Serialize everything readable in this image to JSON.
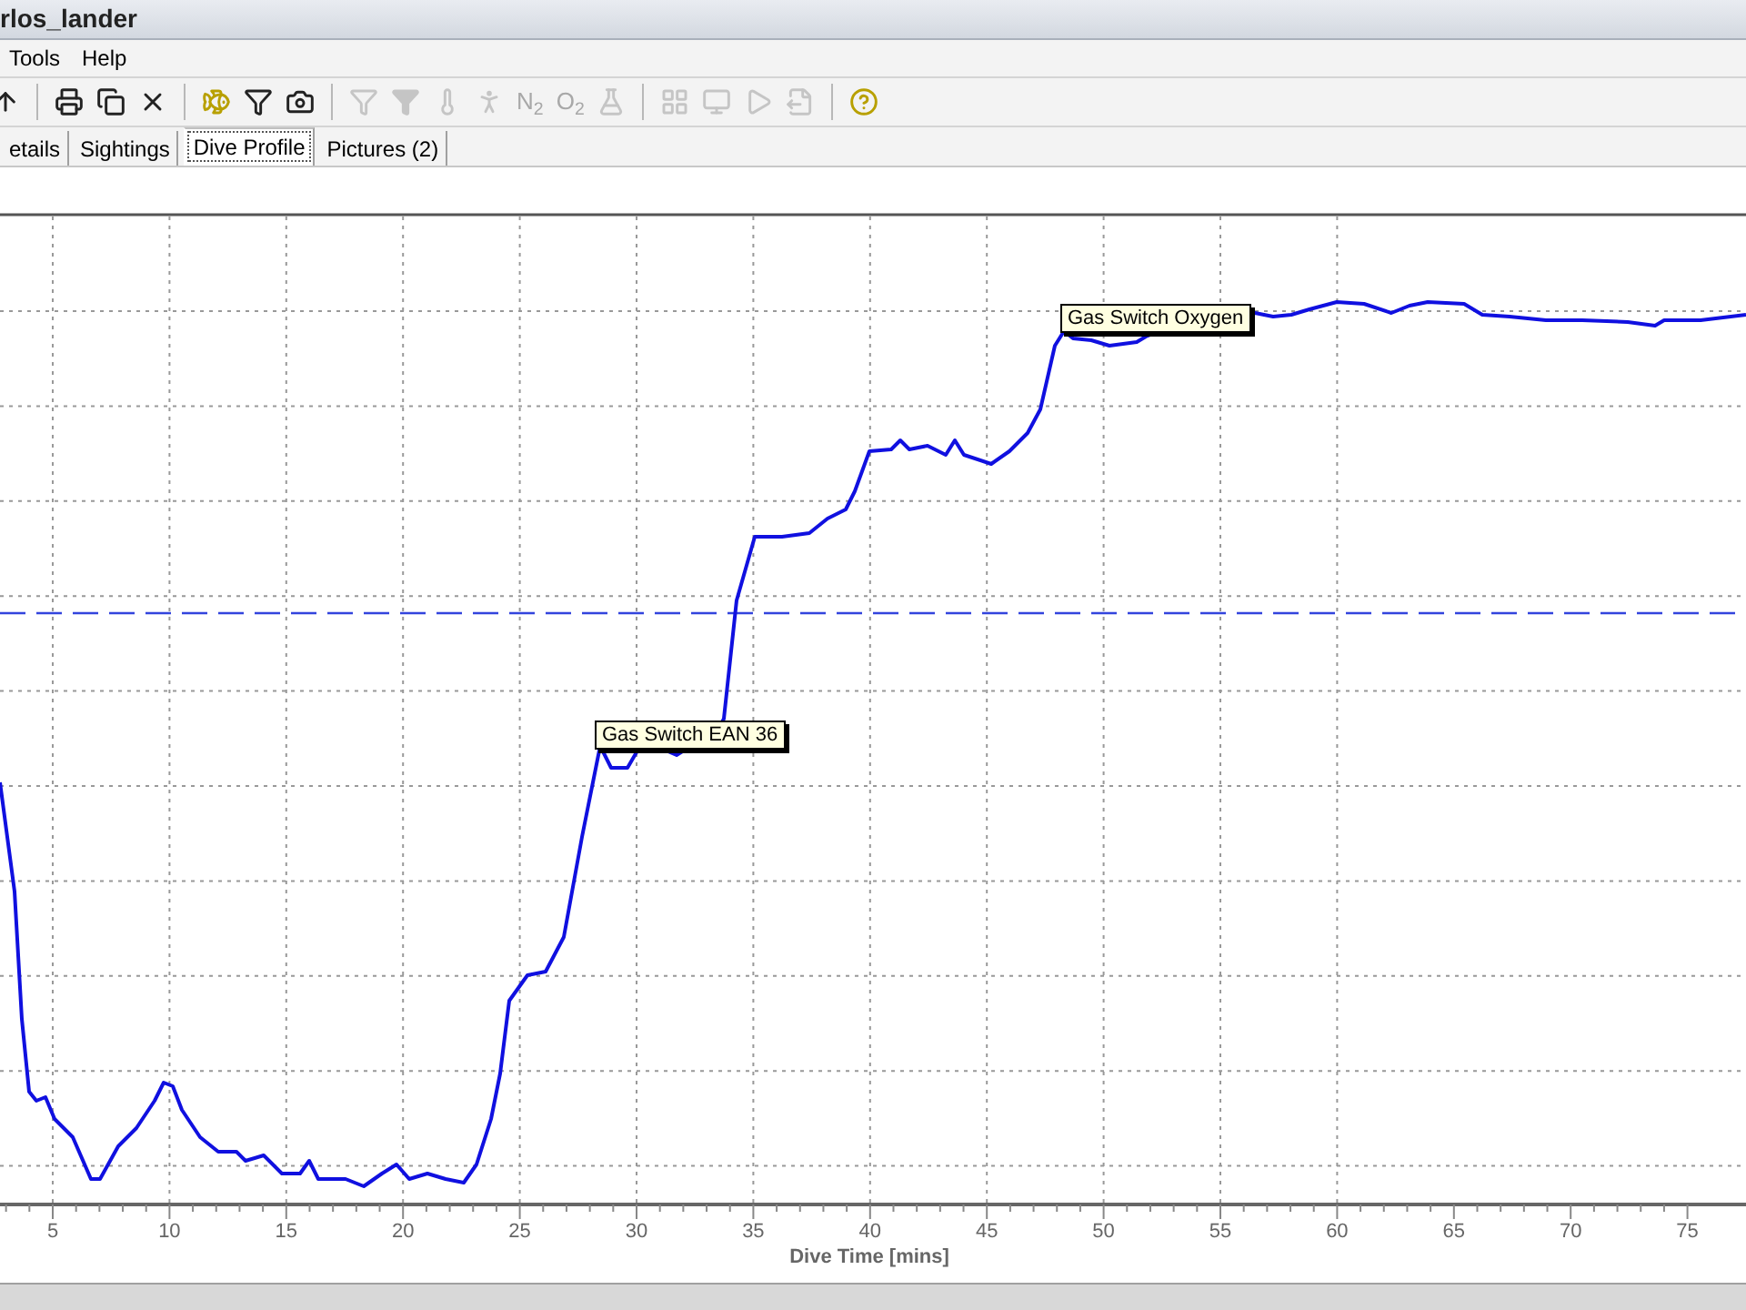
{
  "window": {
    "title": "rlos_lander"
  },
  "menu": [
    "Tools",
    "Help"
  ],
  "toolbar": [
    {
      "kind": "up",
      "disabled": false
    },
    {
      "kind": "separator"
    },
    {
      "kind": "print",
      "disabled": false
    },
    {
      "kind": "copy",
      "disabled": false
    },
    {
      "kind": "delete",
      "disabled": false
    },
    {
      "kind": "separator"
    },
    {
      "kind": "fish",
      "disabled": false
    },
    {
      "kind": "funnel",
      "disabled": false
    },
    {
      "kind": "camera",
      "disabled": false
    },
    {
      "kind": "separator"
    },
    {
      "kind": "funnel",
      "disabled": true
    },
    {
      "kind": "funnel-filled",
      "disabled": true
    },
    {
      "kind": "thermometer",
      "disabled": true
    },
    {
      "kind": "person",
      "disabled": true
    },
    {
      "kind": "text",
      "label": "N$_{2}$",
      "disabled": true
    },
    {
      "kind": "text",
      "label": "O$_{2}$",
      "disabled": true
    },
    {
      "kind": "flask",
      "disabled": true
    },
    {
      "kind": "separator"
    },
    {
      "kind": "grid",
      "disabled": true
    },
    {
      "kind": "monitor",
      "disabled": true
    },
    {
      "kind": "play",
      "disabled": true
    },
    {
      "kind": "export",
      "disabled": true
    },
    {
      "kind": "separator"
    },
    {
      "kind": "help",
      "disabled": false
    }
  ],
  "tabs": [
    {
      "label": "etails",
      "selected": false
    },
    {
      "label": "Sightings",
      "selected": false
    },
    {
      "label": "Dive Profile",
      "selected": true
    },
    {
      "label": "Pictures (2)",
      "selected": false
    }
  ],
  "chart": {
    "x_ticks": [
      "5",
      "10",
      "15",
      "20",
      "25",
      "30",
      "35",
      "40",
      "45",
      "50",
      "55",
      "60",
      "65",
      "70",
      "75"
    ],
    "x_label": "Dive Time [mins]",
    "annotations": [
      {
        "text": "Gas Switch EAN 36"
      },
      {
        "text": "Gas Switch Oxygen"
      }
    ]
  }
}
